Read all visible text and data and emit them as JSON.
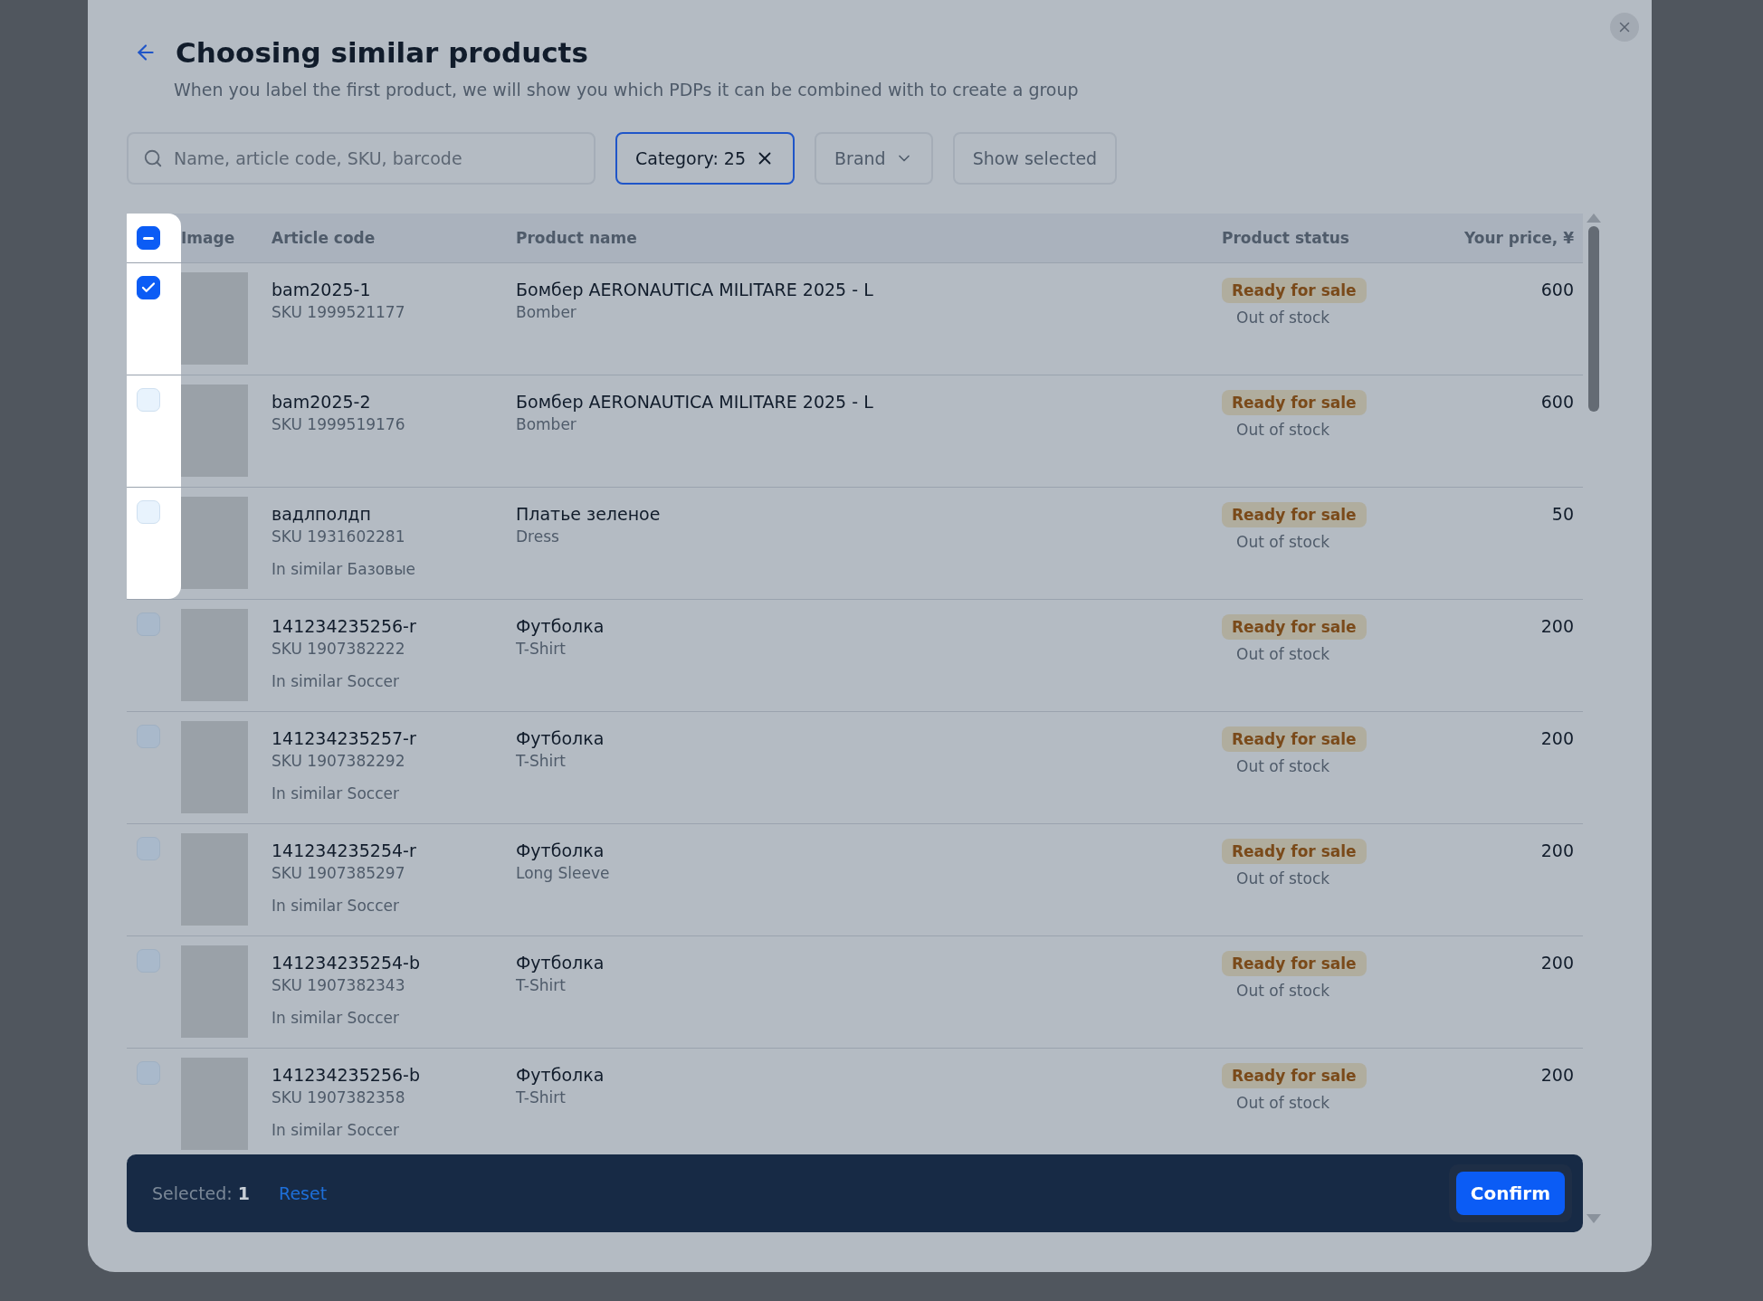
{
  "dialog": {
    "title": "Choosing similar products",
    "subtitle": "When you label the first product, we will show you which PDPs it can be combined with to create a group"
  },
  "search": {
    "placeholder": "Name, article code, SKU, barcode"
  },
  "filters": [
    {
      "kind": "chip",
      "label": "Category: 25",
      "active": true
    },
    {
      "kind": "dropdown",
      "label": "Brand"
    },
    {
      "kind": "button",
      "label": "Show selected"
    }
  ],
  "table": {
    "select_all": {
      "indeterminate": true,
      "highlighted": true
    },
    "columns": [
      "Image",
      "Article code",
      "Product name",
      "Product status",
      "Your price, ¥"
    ],
    "rows": [
      {
        "checked": true,
        "highlighted": true,
        "article": "bam2025-1",
        "sku": "SKU 1999521177",
        "name": "Бомбер AERONAUTICA MILITARE 2025 - L",
        "type": "Bomber",
        "status": "Ready for sale",
        "stock": "Out of stock",
        "price": "600"
      },
      {
        "checked": false,
        "highlighted": true,
        "article": "bam2025-2",
        "sku": "SKU 1999519176",
        "name": "Бомбер AERONAUTICA MILITARE 2025 - L",
        "type": "Bomber",
        "status": "Ready for sale",
        "stock": "Out of stock",
        "price": "600"
      },
      {
        "checked": false,
        "highlighted": true,
        "article": "вадлполдп",
        "sku": "SKU 1931602281",
        "similar": "In similar Базовые",
        "name": "Платье зеленое",
        "type": "Dress",
        "status": "Ready for sale",
        "stock": "Out of stock",
        "price": "50"
      },
      {
        "checked": false,
        "highlighted": false,
        "article": "141234235256-r",
        "sku": "SKU 1907382222",
        "similar": "In similar Soccer",
        "name": "Футболка",
        "type": "T-Shirt",
        "status": "Ready for sale",
        "stock": "Out of stock",
        "price": "200"
      },
      {
        "checked": false,
        "highlighted": false,
        "article": "141234235257-r",
        "sku": "SKU 1907382292",
        "similar": "In similar Soccer",
        "name": "Футболка",
        "type": "T-Shirt",
        "status": "Ready for sale",
        "stock": "Out of stock",
        "price": "200"
      },
      {
        "checked": false,
        "highlighted": false,
        "article": "141234235254-r",
        "sku": "SKU 1907385297",
        "similar": "In similar Soccer",
        "name": "Футболка",
        "type": "Long Sleeve",
        "status": "Ready for sale",
        "stock": "Out of stock",
        "price": "200"
      },
      {
        "checked": false,
        "highlighted": false,
        "article": "141234235254-b",
        "sku": "SKU 1907382343",
        "similar": "In similar Soccer",
        "name": "Футболка",
        "type": "T-Shirt",
        "status": "Ready for sale",
        "stock": "Out of stock",
        "price": "200"
      },
      {
        "checked": false,
        "highlighted": false,
        "article": "141234235256-b",
        "sku": "SKU 1907382358",
        "similar": "In similar Soccer",
        "name": "Футболка",
        "type": "T-Shirt",
        "status": "Ready for sale",
        "stock": "Out of stock",
        "price": "200"
      }
    ]
  },
  "footer": {
    "selected": "Selected: **1**",
    "reset": "Reset",
    "confirm": "Confirm"
  }
}
